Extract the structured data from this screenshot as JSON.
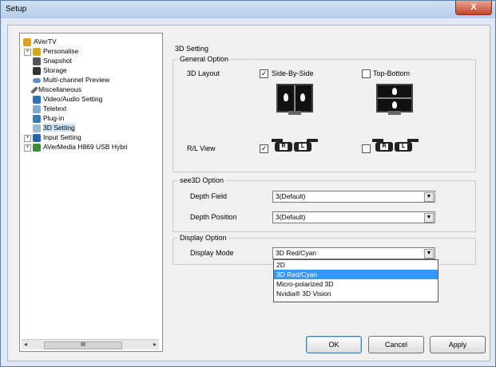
{
  "window": {
    "title": "Setup",
    "close_label": "X"
  },
  "tree": {
    "items": [
      {
        "label": "AVerTV",
        "icon": "avertv-icon"
      },
      {
        "label": "Personalise",
        "icon": "personalise-icon",
        "expander": "+"
      },
      {
        "label": "Snapshot",
        "icon": "camera-icon"
      },
      {
        "label": "Storage",
        "icon": "disk-icon"
      },
      {
        "label": "Multi-channel Preview",
        "icon": "eye-icon"
      },
      {
        "label": "Miscellaneous",
        "icon": "pen-icon"
      },
      {
        "label": "Video/Audio Setting",
        "icon": "tools-icon"
      },
      {
        "label": "Teletext",
        "icon": "teletext-icon"
      },
      {
        "label": "Plug-in",
        "icon": "plugin-icon"
      },
      {
        "label": "3D Setting",
        "icon": "3d-icon"
      },
      {
        "label": "Input Setting",
        "icon": "input-icon",
        "expander": "+"
      },
      {
        "label": "AVerMedia H869 USB Hybri",
        "icon": "device-icon",
        "expander": "+"
      }
    ],
    "scroll_thumb": "III"
  },
  "main": {
    "heading": "3D Setting",
    "general": {
      "title": "General Option",
      "layout_label": "3D Layout",
      "side_by_side": "Side-By-Side",
      "side_by_side_checked": true,
      "top_bottom": "Top-Bottom",
      "top_bottom_checked": false,
      "rl_view_label": "R/L View",
      "rl_checked": true,
      "lr_checked": false,
      "lens_r": "R",
      "lens_l": "L"
    },
    "see3d": {
      "title": "see3D Option",
      "depth_field_label": "Depth Field",
      "depth_field_value": "3(Default)",
      "depth_position_label": "Depth Position",
      "depth_position_value": "3(Default)"
    },
    "display": {
      "title": "Display Option",
      "mode_label": "Display Mode",
      "mode_value": "3D Red/Cyan",
      "options": [
        "2D",
        "3D Red/Cyan",
        "Micro-polarized 3D",
        "Nvidia® 3D Vision"
      ],
      "highlighted_option": "3D Red/Cyan"
    }
  },
  "buttons": {
    "ok": "OK",
    "cancel": "Cancel",
    "apply": "Apply"
  },
  "colors": {
    "selection": "#3399ff",
    "titlebar": "#b7cde8",
    "close": "#c4452c"
  }
}
